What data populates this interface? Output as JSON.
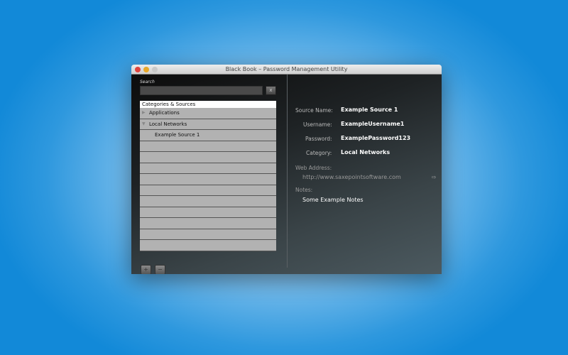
{
  "window": {
    "title": "Black Book – Password Management Utility"
  },
  "search": {
    "label": "Search",
    "value": "",
    "clear_icon": "x"
  },
  "list": {
    "header": "Categories & Sources",
    "rows": [
      {
        "label": "Applications",
        "arrow": "▶"
      },
      {
        "label": "Local Networks",
        "arrow": "▼"
      },
      {
        "label": "Example Source 1",
        "arrow": ""
      }
    ],
    "empty_rows": 10
  },
  "buttons": {
    "add": "+",
    "remove": "−"
  },
  "detail": {
    "source_name_label": "Source Name:",
    "source_name": "Example Source 1",
    "username_label": "Username:",
    "username": "ExampleUsername1",
    "password_label": "Password:",
    "password": "ExamplePassword123",
    "category_label": "Category:",
    "category": "Local Networks",
    "web_label": "Web Address:",
    "web": "http://www.saxepointsoftware.com",
    "go_icon": "⇨",
    "notes_label": "Notes:",
    "notes": "Some Example Notes"
  }
}
